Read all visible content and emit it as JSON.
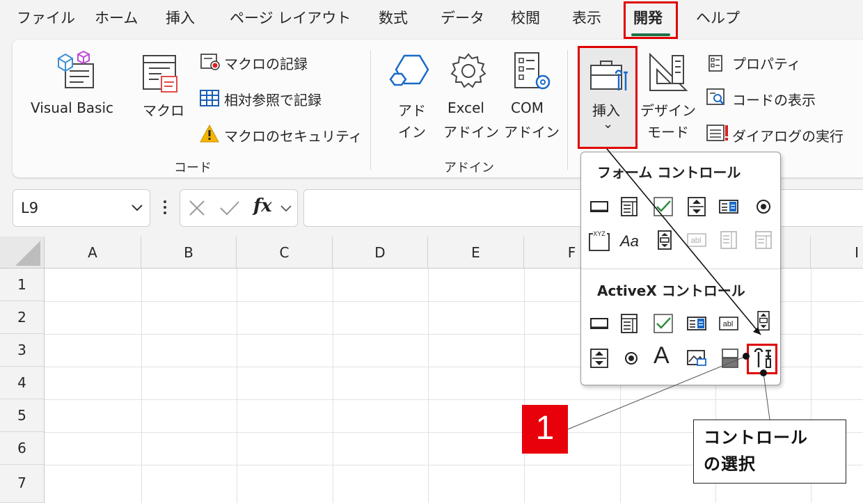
{
  "menu": {
    "tabs": [
      "ファイル",
      "ホーム",
      "挿入",
      "ページ レイアウト",
      "数式",
      "データ",
      "校閲",
      "表示",
      "開発",
      "ヘルプ"
    ],
    "active_tab": "開発"
  },
  "ribbon": {
    "code_group": {
      "visual_basic": "Visual Basic",
      "macro": "マクロ",
      "record_macro": "マクロの記録",
      "relative_ref": "相対参照で記録",
      "macro_security": "マクロのセキュリティ",
      "label": "コード"
    },
    "addin_group": {
      "addin_line1": "アド",
      "addin_line2": "イン",
      "excel_addin_line1": "Excel",
      "excel_addin_line2": "アドイン",
      "com_addin_line1": "COM",
      "com_addin_line2": "アドイン",
      "label": "アドイン"
    },
    "controls_group": {
      "insert": "挿入",
      "insert_chevron": "⌄",
      "design_line1": "デザイン",
      "design_line2": "モード",
      "properties": "プロパティ",
      "view_code": "コードの表示",
      "run_dialog": "ダイアログの実行"
    }
  },
  "formula_bar": {
    "name_box": "L9",
    "fx": "fx"
  },
  "grid": {
    "columns": [
      "A",
      "B",
      "C",
      "D",
      "E",
      "F",
      "I"
    ],
    "rows": [
      "1",
      "2",
      "3",
      "4",
      "5",
      "6",
      "7"
    ]
  },
  "dropdown": {
    "form_controls_title": "フォーム コントロール",
    "activex_controls_title": "ActiveX コントロール",
    "xyz_label": "XYZ",
    "aa_label": "Aa",
    "abl_label": "abl",
    "a_label": "A"
  },
  "annotation": {
    "badge": "1",
    "callout_line1": "コントロール",
    "callout_line2": "の選択"
  },
  "colors": {
    "highlight_red": "#e00000",
    "badge_red": "#e8000b",
    "excel_green": "#1e7145",
    "check_green": "#2e8b3d"
  }
}
